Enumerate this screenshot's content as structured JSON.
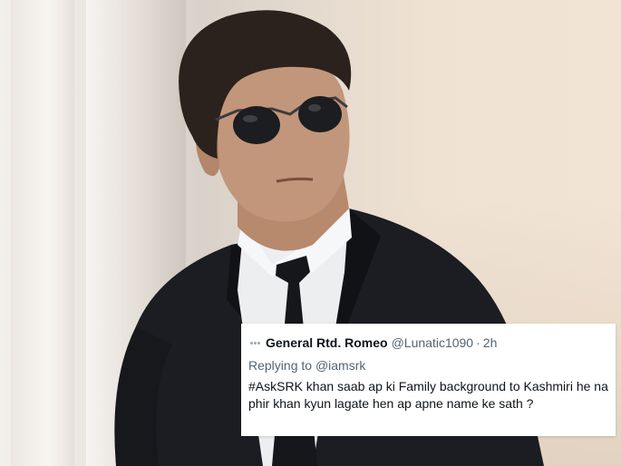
{
  "photo": {
    "subject": "man-in-black-suit-and-sunglasses"
  },
  "tweet": {
    "author_name": "General Rtd. Romeo",
    "author_handle": "@Lunatic1090",
    "time_separator": "·",
    "time": "2h",
    "replying_prefix": "Replying to",
    "replying_to": "@iamsrk",
    "text": "#AskSRK khan saab ap ki Family background to Kashmiri he na phir khan kyun lagate hen ap apne name ke sath ?"
  },
  "colors": {
    "card_bg": "#ffffff",
    "text_primary": "#0f1419",
    "text_secondary": "#536471",
    "suit": "#1b1d22"
  }
}
